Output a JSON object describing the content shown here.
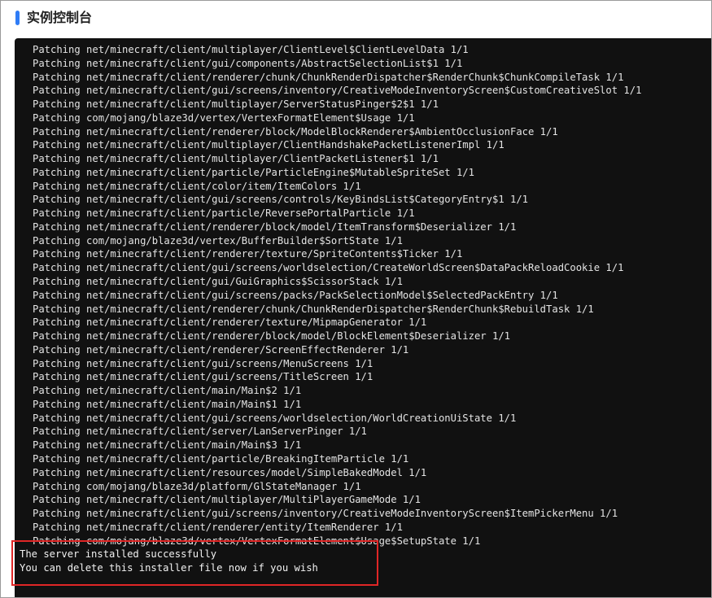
{
  "header": {
    "title": "实例控制台"
  },
  "console": {
    "log_lines": [
      "Patching net/minecraft/client/multiplayer/ClientLevel$ClientLevelData 1/1",
      "Patching net/minecraft/client/gui/components/AbstractSelectionList$1 1/1",
      "Patching net/minecraft/client/renderer/chunk/ChunkRenderDispatcher$RenderChunk$ChunkCompileTask 1/1",
      "Patching net/minecraft/client/gui/screens/inventory/CreativeModeInventoryScreen$CustomCreativeSlot 1/1",
      "Patching net/minecraft/client/multiplayer/ServerStatusPinger$2$1 1/1",
      "Patching com/mojang/blaze3d/vertex/VertexFormatElement$Usage 1/1",
      "Patching net/minecraft/client/renderer/block/ModelBlockRenderer$AmbientOcclusionFace 1/1",
      "Patching net/minecraft/client/multiplayer/ClientHandshakePacketListenerImpl 1/1",
      "Patching net/minecraft/client/multiplayer/ClientPacketListener$1 1/1",
      "Patching net/minecraft/client/particle/ParticleEngine$MutableSpriteSet 1/1",
      "Patching net/minecraft/client/color/item/ItemColors 1/1",
      "Patching net/minecraft/client/gui/screens/controls/KeyBindsList$CategoryEntry$1 1/1",
      "Patching net/minecraft/client/particle/ReversePortalParticle 1/1",
      "Patching net/minecraft/client/renderer/block/model/ItemTransform$Deserializer 1/1",
      "Patching com/mojang/blaze3d/vertex/BufferBuilder$SortState 1/1",
      "Patching net/minecraft/client/renderer/texture/SpriteContents$Ticker 1/1",
      "Patching net/minecraft/client/gui/screens/worldselection/CreateWorldScreen$DataPackReloadCookie 1/1",
      "Patching net/minecraft/client/gui/GuiGraphics$ScissorStack 1/1",
      "Patching net/minecraft/client/gui/screens/packs/PackSelectionModel$SelectedPackEntry 1/1",
      "Patching net/minecraft/client/renderer/chunk/ChunkRenderDispatcher$RenderChunk$RebuildTask 1/1",
      "Patching net/minecraft/client/renderer/texture/MipmapGenerator 1/1",
      "Patching net/minecraft/client/renderer/block/model/BlockElement$Deserializer 1/1",
      "Patching net/minecraft/client/renderer/ScreenEffectRenderer 1/1",
      "Patching net/minecraft/client/gui/screens/MenuScreens 1/1",
      "Patching net/minecraft/client/gui/screens/TitleScreen 1/1",
      "Patching net/minecraft/client/main/Main$2 1/1",
      "Patching net/minecraft/client/main/Main$1 1/1",
      "Patching net/minecraft/client/gui/screens/worldselection/WorldCreationUiState 1/1",
      "Patching net/minecraft/client/server/LanServerPinger 1/1",
      "Patching net/minecraft/client/main/Main$3 1/1",
      "Patching net/minecraft/client/particle/BreakingItemParticle 1/1",
      "Patching net/minecraft/client/resources/model/SimpleBakedModel 1/1",
      "Patching com/mojang/blaze3d/platform/GlStateManager 1/1",
      "Patching net/minecraft/client/multiplayer/MultiPlayerGameMode 1/1",
      "Patching net/minecraft/client/gui/screens/inventory/CreativeModeInventoryScreen$ItemPickerMenu 1/1",
      "Patching net/minecraft/client/renderer/entity/ItemRenderer 1/1",
      "Patching com/mojang/blaze3d/vertex/VertexFormatElement$Usage$SetupState 1/1"
    ],
    "final_lines": [
      "The server installed successfully",
      "You can delete this installer file now if you wish"
    ]
  },
  "colors": {
    "accent": "#2f7cf6",
    "console_bg": "#111111",
    "console_text": "#e4e4e4",
    "highlight": "#e02626"
  }
}
